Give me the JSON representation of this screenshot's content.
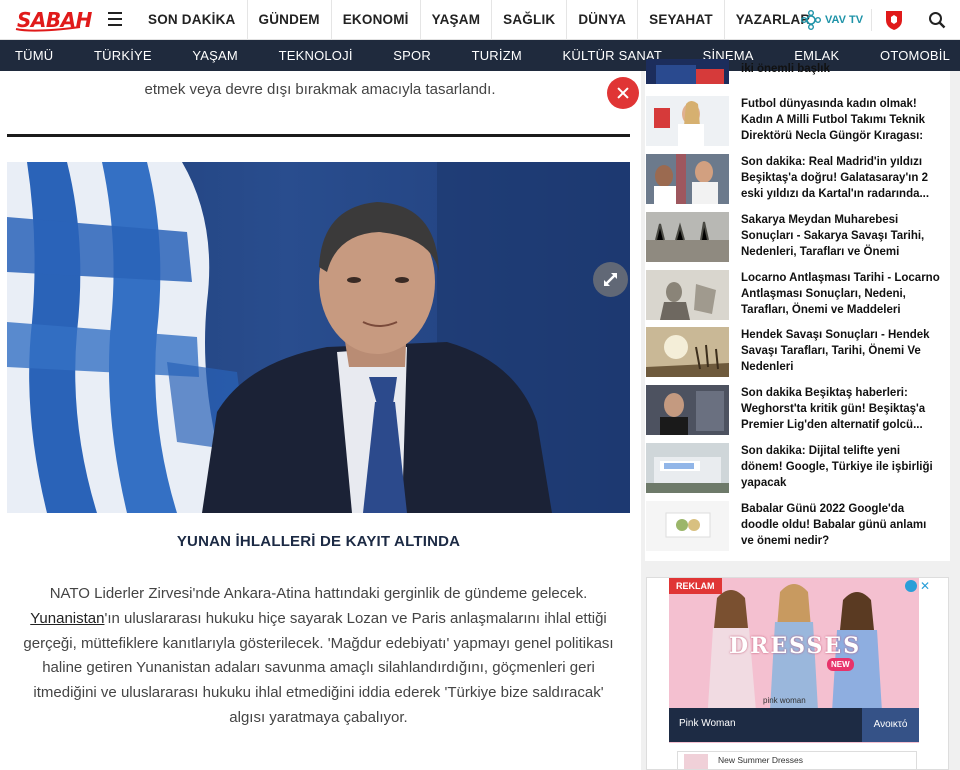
{
  "header": {
    "logo_text": "SABAH",
    "nav": [
      "SON DAKİKA",
      "GÜNDEM",
      "EKONOMİ",
      "YAŞAM",
      "SAĞLIK",
      "DÜNYA",
      "SEYAHAT",
      "YAZARLAR"
    ],
    "vav_label": "VAV TV"
  },
  "categories": [
    "TÜMÜ",
    "TÜRKİYE",
    "YAŞAM",
    "TEKNOLOJİ",
    "SPOR",
    "TURİZM",
    "KÜLTÜR SANAT",
    "SİNEMA",
    "EMLAK",
    "OTOMOBİL"
  ],
  "article": {
    "prev_paragraph_end": "etmek veya devre dışı bırakmak amacıyla tasarlandı.",
    "section_title": "YUNAN İHLALLERİ DE KAYIT ALTINDA",
    "body_before_link": "NATO Liderler Zirvesi'nde Ankara-Atina hattındaki gerginlik de gündeme gelecek.",
    "body_link": "Yunanistan",
    "body_after_link": "'ın uluslararası hukuku hiçe sayarak Lozan ve Paris anlaşmalarını ihlal ettiği gerçeği, müttefiklere kanıtlarıyla gösterilecek. 'Mağdur edebiyatı' yapmayı genel politikası haline getiren Yunanistan adaları savunma amaçlı silahlandırdığını, göçmenleri geri itmediğini ve uluslararası hukuku ihlal etmediğini iddia ederek 'Türkiye bize saldıracak' algısı yaratmaya çabalıyor."
  },
  "sidebar": {
    "news": [
      {
        "title": "iki önemli başlık"
      },
      {
        "title": "Futbol dünyasında kadın olmak! Kadın A Milli Futbol Takımı Teknik Direktörü Necla Güngör Kıragası:"
      },
      {
        "title": "Son dakika: Real Madrid'in yıldızı Beşiktaş'a doğru! Galatasaray'ın 2 eski yıldızı da Kartal'ın radarında..."
      },
      {
        "title": "Sakarya Meydan Muharebesi Sonuçları - Sakarya Savaşı Tarihi, Nedenleri, Tarafları ve Önemi"
      },
      {
        "title": "Locarno Antlaşması Tarihi - Locarno Antlaşması Sonuçları, Nedeni, Tarafları, Önemi ve Maddeleri"
      },
      {
        "title": "Hendek Savaşı Sonuçları - Hendek Savaşı Tarafları, Tarihi, Önemi Ve Nedenleri"
      },
      {
        "title": "Son dakika Beşiktaş haberleri: Weghorst'ta kritik gün! Beşiktaş'a Premier Lig'den alternatif golcü..."
      },
      {
        "title": "Son dakika: Dijital telifte yeni dönem! Google, Türkiye ile işbirliği yapacak"
      },
      {
        "title": "Babalar Günü 2022 Google'da doodle oldu! Babalar günü anlamı ve önemi nedir?"
      }
    ],
    "ad": {
      "badge": "REKLAM",
      "headline": "DRESSES",
      "new_label": "NEW",
      "brand_small": "pink woman",
      "advertiser": "Pink Woman",
      "cta": "Ανοικτό",
      "bottom_text": "New Summer Dresses"
    }
  },
  "colors": {
    "brand_red": "#e01a1a",
    "category_bar": "#1f2a3d",
    "close_button": "#e03535"
  }
}
